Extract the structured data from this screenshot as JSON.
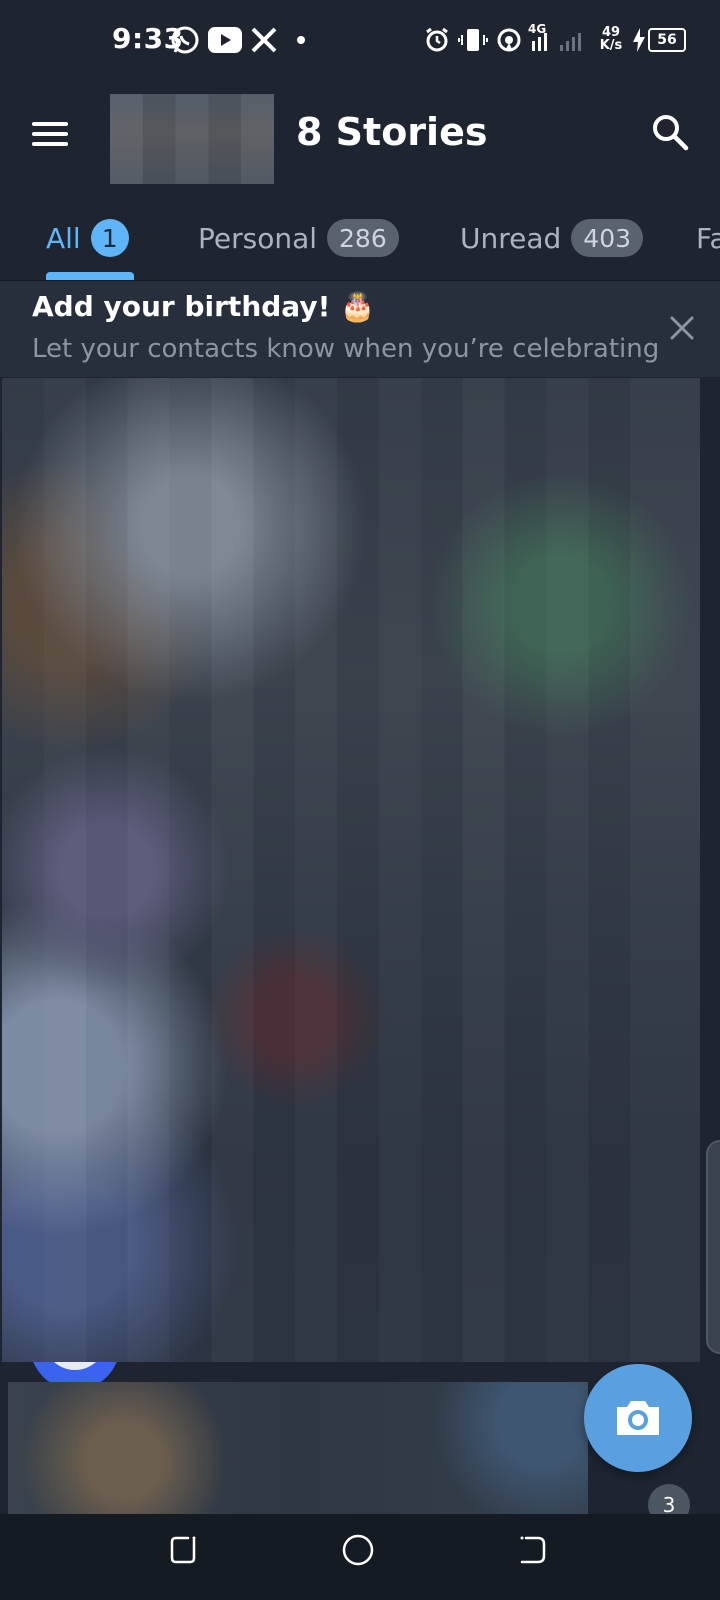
{
  "status_bar": {
    "time": "9:33",
    "net_speed_value": "49",
    "net_speed_unit": "K/s",
    "network_type": "4G",
    "battery": "56",
    "notification_icons": [
      "whatsapp-icon",
      "youtube-icon",
      "x-icon",
      "dot-icon"
    ],
    "system_icons": [
      "alarm-icon",
      "vibrate-icon",
      "hotspot-icon",
      "signal-icon",
      "charging-icon",
      "battery-icon"
    ]
  },
  "header": {
    "title": "8 Stories"
  },
  "tabs": [
    {
      "label": "All",
      "count": "1",
      "active": true
    },
    {
      "label": "Personal",
      "count": "286"
    },
    {
      "label": "Unread",
      "count": "403"
    },
    {
      "label": "Fa"
    }
  ],
  "banner": {
    "title": "Add your birthday! 🎂",
    "subtitle": "Let your contacts know when you’re celebrating"
  },
  "list": {
    "partial_badge": "3"
  },
  "colors": {
    "accent": "#5eb5f7",
    "background": "#1e2530",
    "fab": "#5a9fe0"
  }
}
